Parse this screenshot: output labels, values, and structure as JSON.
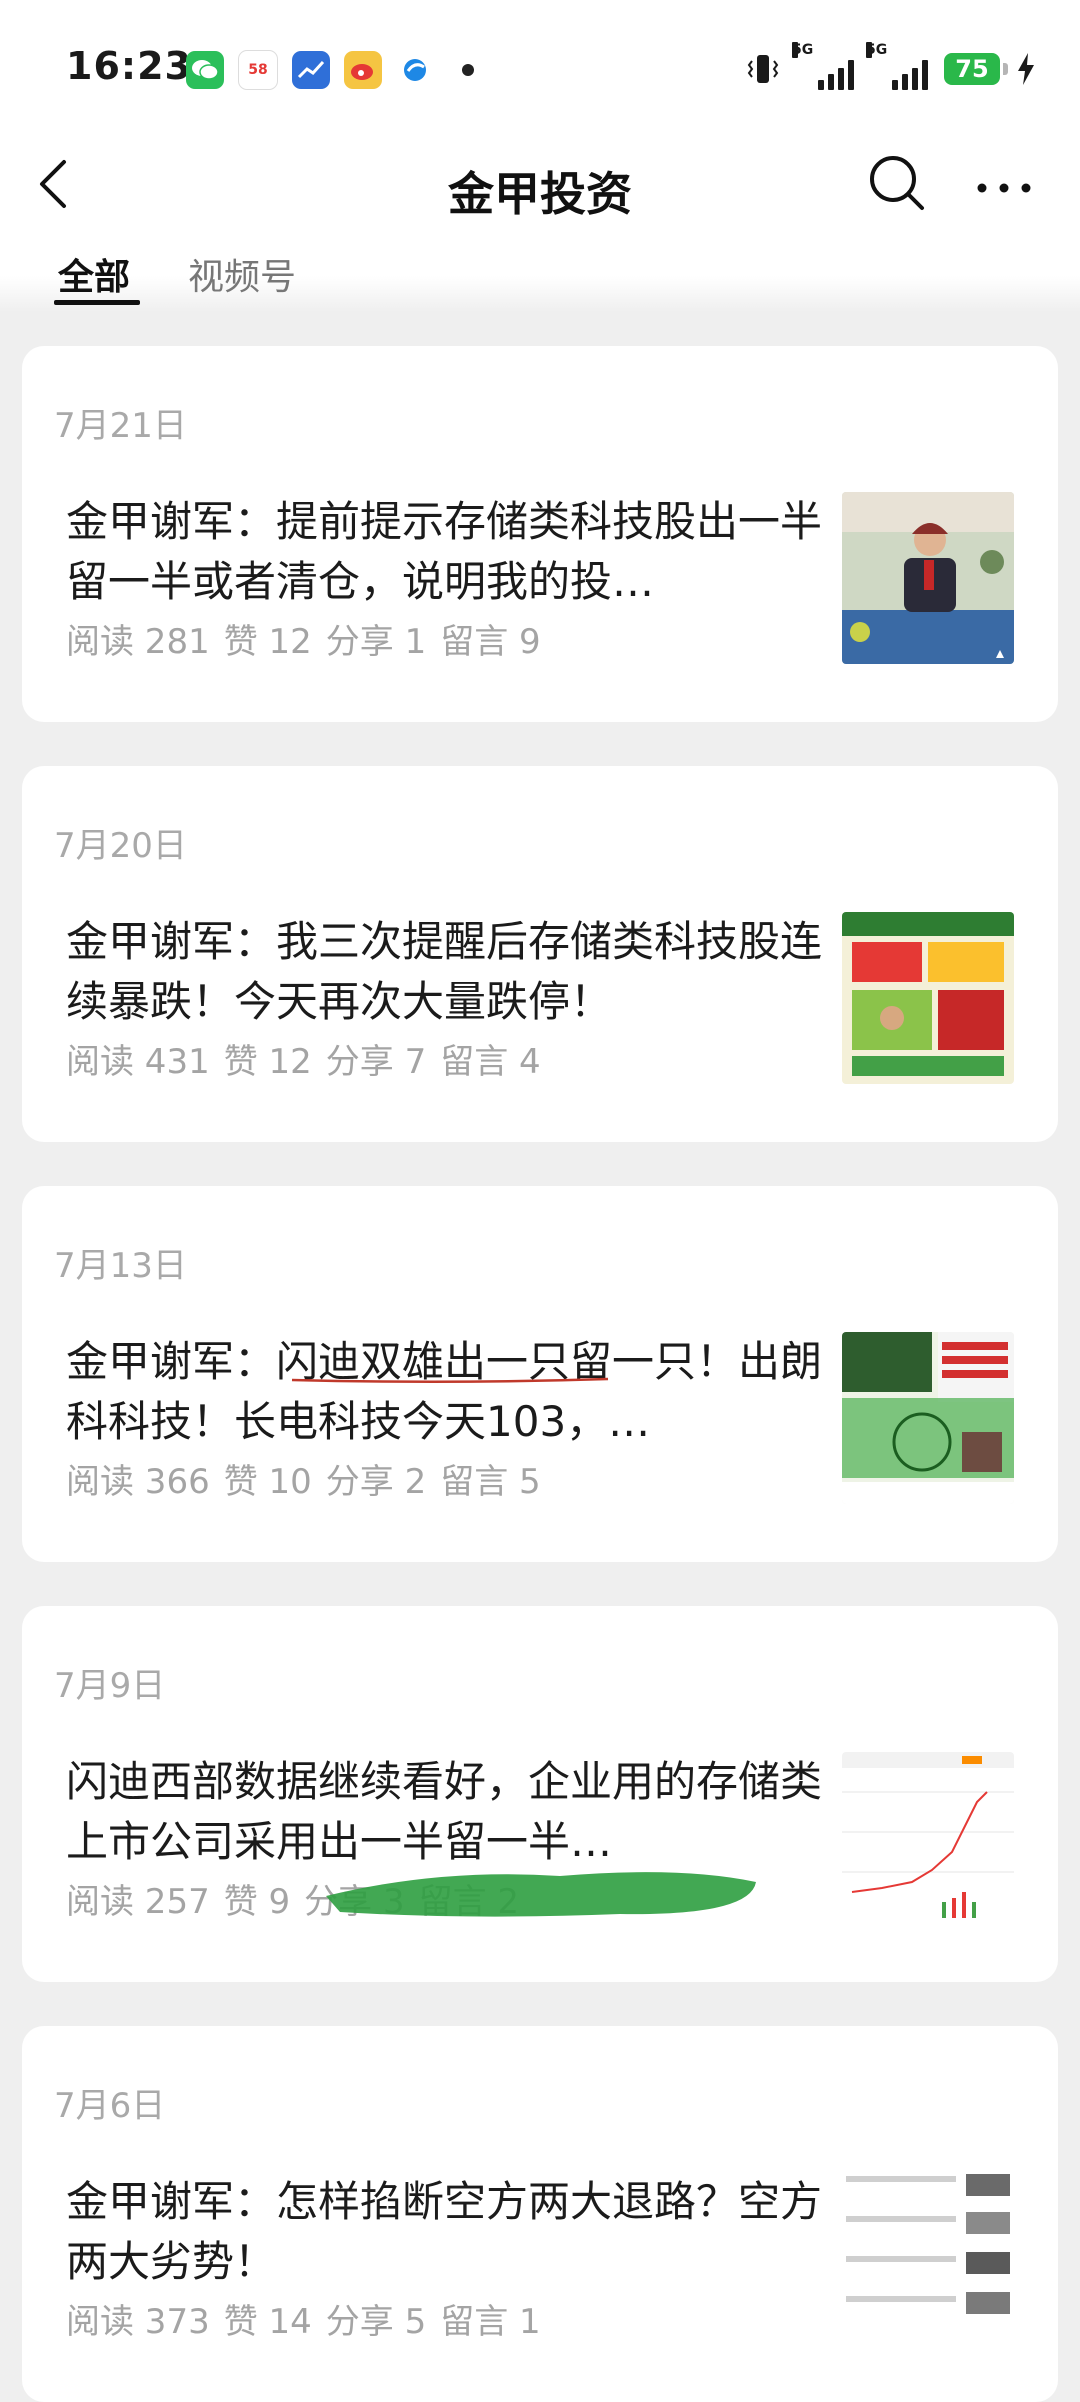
{
  "status": {
    "time": "16:23",
    "apps": [
      "wechat-icon",
      "58-icon",
      "stocks-icon",
      "weibo-icon",
      "browser-icon"
    ],
    "sig1": "5G",
    "sig2": "5G",
    "battery": "75"
  },
  "nav": {
    "title": "金甲投资"
  },
  "tabs": {
    "all": "全部",
    "video": "视频号"
  },
  "articles": [
    {
      "date": "7月21日",
      "title": "金甲谢军：提前提示存储类科技股出一半留一半或者清仓，说明我的投…",
      "reads": "阅读 281",
      "likes": "赞 12",
      "shares": "分享 1",
      "comments": "留言 9"
    },
    {
      "date": "7月20日",
      "title": "金甲谢军：我三次提醒后存储类科技股连续暴跌！今天再次大量跌停！",
      "reads": "阅读 431",
      "likes": "赞 12",
      "shares": "分享 7",
      "comments": "留言 4"
    },
    {
      "date": "7月13日",
      "title": "金甲谢军：闪迪双雄出一只留一只！出朗科科技！长电科技今天103，…",
      "reads": "阅读 366",
      "likes": "赞 10",
      "shares": "分享 2",
      "comments": "留言 5"
    },
    {
      "date": "7月9日",
      "title": "闪迪西部数据继续看好，企业用的存储类上市公司采用出一半留一半…",
      "reads": "阅读 257",
      "likes": "赞 9",
      "shares": "分享 3",
      "comments": "留言 2"
    },
    {
      "date": "7月6日",
      "title": "金甲谢军：怎样掐断空方两大退路？空方两大劣势！",
      "reads": "阅读 373",
      "likes": "赞 14",
      "shares": "分享 5",
      "comments": "留言 1"
    }
  ],
  "colors": {
    "accent": "#2ab84a",
    "background": "#efefef"
  }
}
